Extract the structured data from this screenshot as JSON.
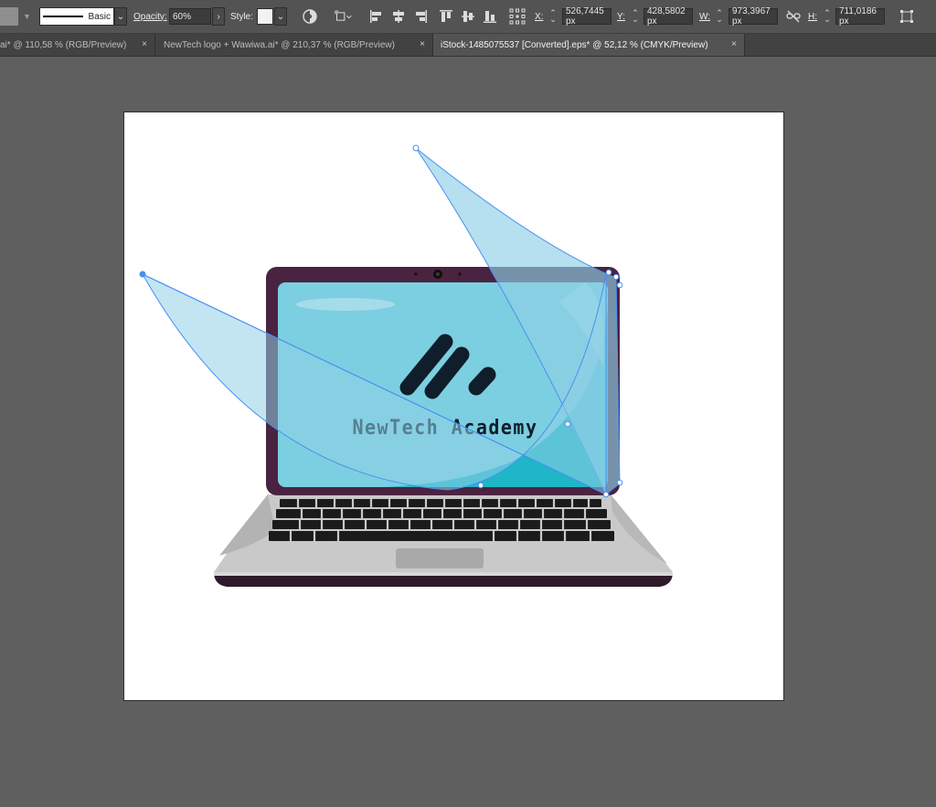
{
  "control_bar": {
    "stroke_style": "Basic",
    "opacity_label": "Opacity:",
    "opacity_value": "60%",
    "style_label": "Style:",
    "x_label": "X:",
    "x_value": "526,7445 px",
    "y_label": "Y:",
    "y_value": "428,5802 px",
    "w_label": "W:",
    "w_value": "973,3967 px",
    "h_label": "H:",
    "h_value": "711,0186 px"
  },
  "tabs": [
    {
      "label": "ai* @ 110,58 % (RGB/Preview)",
      "active": false
    },
    {
      "label": "NewTech logo + Wawiwa.ai* @ 210,37 % (RGB/Preview)",
      "active": false
    },
    {
      "label": "iStock-1485075537 [Converted].eps* @ 52,12 % (CMYK/Preview)",
      "active": true
    }
  ],
  "tab_close_glyph": "×",
  "artwork": {
    "logo_text": "NewTech Academy",
    "colors": {
      "laptop_frame": "#4a2340",
      "screen": "#7ccfe0",
      "screen_accent": "#1fb6c8",
      "logo_dark": "#0f1e2a",
      "keyboard_base": "#c9c9c9",
      "selection": "#4a8ff0",
      "shape_fill": "#8fd0e6"
    }
  },
  "icons": {
    "recolor": "recolor-artwork-icon",
    "align_left": "align-left-icon",
    "align_center": "align-horizontal-center-icon",
    "align_right": "align-right-icon",
    "align_top": "align-top-icon",
    "align_middle": "align-vertical-center-icon",
    "align_bottom": "align-bottom-icon",
    "reference_point": "reference-point-icon",
    "constrain": "constrain-proportions-icon",
    "transform": "transform-icon"
  }
}
